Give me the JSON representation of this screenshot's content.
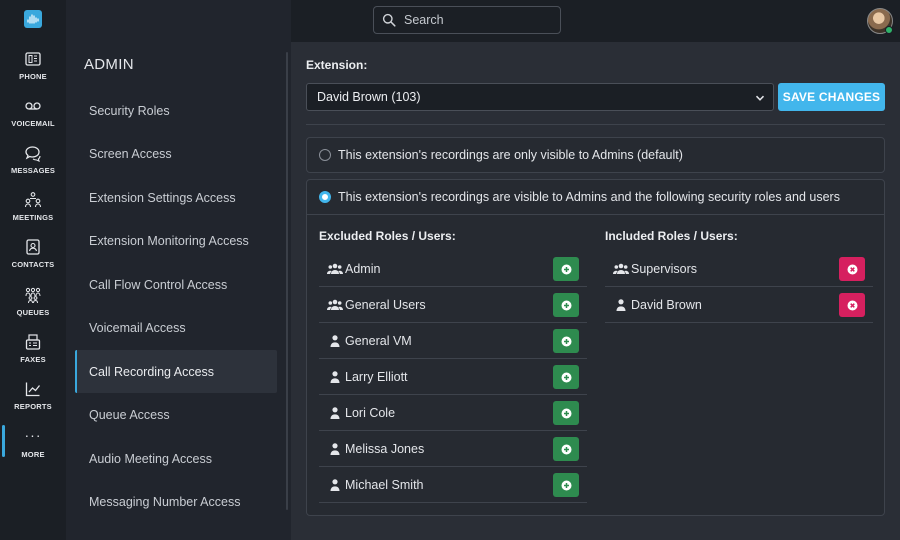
{
  "search": {
    "placeholder": "Search"
  },
  "rail": {
    "items": [
      {
        "label": "PHONE",
        "icon": "phone-icon"
      },
      {
        "label": "VOICEMAIL",
        "icon": "voicemail-icon"
      },
      {
        "label": "MESSAGES",
        "icon": "messages-icon"
      },
      {
        "label": "MEETINGS",
        "icon": "meetings-icon"
      },
      {
        "label": "CONTACTS",
        "icon": "contacts-icon"
      },
      {
        "label": "QUEUES",
        "icon": "queues-icon"
      },
      {
        "label": "FAXES",
        "icon": "fax-icon"
      },
      {
        "label": "REPORTS",
        "icon": "reports-icon"
      },
      {
        "label": "MORE",
        "icon": "more-icon",
        "glyph": "···"
      }
    ],
    "active": "MORE"
  },
  "admin": {
    "title": "ADMIN",
    "items": [
      "Security Roles",
      "Screen Access",
      "Extension Settings Access",
      "Extension Monitoring Access",
      "Call Flow Control Access",
      "Voicemail Access",
      "Call Recording Access",
      "Queue Access",
      "Audio Meeting Access",
      "Messaging Number Access"
    ],
    "active": "Call Recording Access"
  },
  "main": {
    "extension_label": "Extension:",
    "extension_value": "David Brown (103)",
    "save_label": "SAVE CHANGES",
    "option_admins_only": "This extension's recordings are only visible to Admins (default)",
    "option_custom": "This extension's recordings are visible to Admins and the following security roles and users",
    "selected_option": "custom",
    "excluded_heading": "Excluded Roles / Users:",
    "included_heading": "Included Roles / Users:",
    "excluded": [
      {
        "name": "Admin",
        "type": "group"
      },
      {
        "name": "General Users",
        "type": "group"
      },
      {
        "name": "General VM",
        "type": "user"
      },
      {
        "name": "Larry Elliott",
        "type": "user"
      },
      {
        "name": "Lori Cole",
        "type": "user"
      },
      {
        "name": "Melissa Jones",
        "type": "user"
      },
      {
        "name": "Michael Smith",
        "type": "user"
      }
    ],
    "included": [
      {
        "name": "Supervisors",
        "type": "group"
      },
      {
        "name": "David Brown",
        "type": "user"
      }
    ]
  },
  "colors": {
    "accent": "#42b6ec",
    "add": "#2e8b4f",
    "remove": "#d6205f",
    "status_online": "#2fb36a"
  }
}
